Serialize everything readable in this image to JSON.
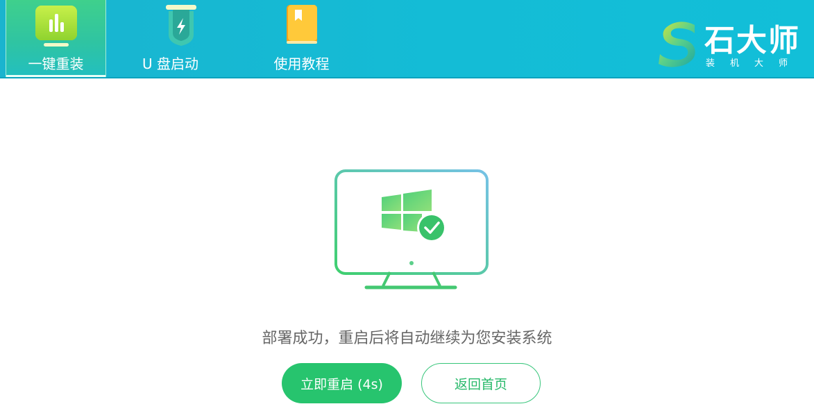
{
  "nav": {
    "items": [
      {
        "label": "一键重装",
        "icon": "bar-chart-icon",
        "active": true
      },
      {
        "label": "U 盘启动",
        "icon": "usb-drive-icon",
        "active": false
      },
      {
        "label": "使用教程",
        "icon": "book-icon",
        "active": false
      }
    ]
  },
  "brand": {
    "title": "石大师",
    "subtitle": "装机大师",
    "logo_icon": "s-logo-icon"
  },
  "main": {
    "illustration_icon": "monitor-windows-check-icon",
    "message": "部署成功，重启后将自动继续为您安装系统",
    "restart_button": "立即重启 (4s)",
    "home_button": "返回首页"
  },
  "colors": {
    "topbar": "#14bcd6",
    "accent_green": "#27c46e"
  }
}
